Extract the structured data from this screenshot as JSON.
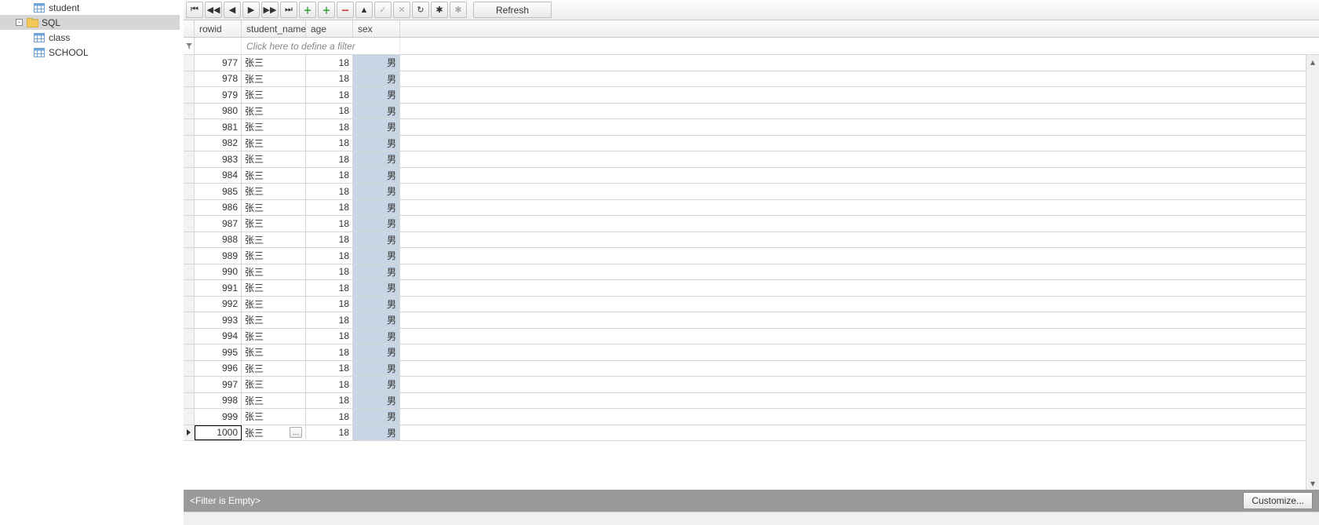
{
  "sidebar": {
    "items": [
      {
        "label": "student",
        "icon": "table-icon",
        "indent": 42,
        "selected": false,
        "expander": null
      },
      {
        "label": "SQL",
        "icon": "folder-icon",
        "indent": 20,
        "selected": true,
        "expander": "-"
      },
      {
        "label": "class",
        "icon": "table-icon",
        "indent": 42,
        "selected": false,
        "expander": null
      },
      {
        "label": "SCHOOL",
        "icon": "table-icon",
        "indent": 42,
        "selected": false,
        "expander": null
      }
    ]
  },
  "toolbar": {
    "nav": {
      "first": "⏮",
      "prev_page": "◀◀",
      "prev": "◀",
      "next": "▶",
      "next_page": "▶▶",
      "last": "⏭"
    },
    "edit": {
      "add": "＋",
      "insert": "＋",
      "delete": "－",
      "edit": "▲",
      "post": "✓",
      "cancel": "✕",
      "refresh_one": "↻",
      "bookmark": "✱",
      "goto_bm": "✱"
    },
    "refresh_label": "Refresh"
  },
  "grid": {
    "columns": {
      "rowid": "rowid",
      "student_name": "student_name",
      "age": "age",
      "sex": "sex"
    },
    "filter_placeholder": "Click here to define a filter",
    "rows": [
      {
        "rowid": 977,
        "student_name": "张三",
        "age": 18,
        "sex": "男"
      },
      {
        "rowid": 978,
        "student_name": "张三",
        "age": 18,
        "sex": "男"
      },
      {
        "rowid": 979,
        "student_name": "张三",
        "age": 18,
        "sex": "男"
      },
      {
        "rowid": 980,
        "student_name": "张三",
        "age": 18,
        "sex": "男"
      },
      {
        "rowid": 981,
        "student_name": "张三",
        "age": 18,
        "sex": "男"
      },
      {
        "rowid": 982,
        "student_name": "张三",
        "age": 18,
        "sex": "男"
      },
      {
        "rowid": 983,
        "student_name": "张三",
        "age": 18,
        "sex": "男"
      },
      {
        "rowid": 984,
        "student_name": "张三",
        "age": 18,
        "sex": "男"
      },
      {
        "rowid": 985,
        "student_name": "张三",
        "age": 18,
        "sex": "男"
      },
      {
        "rowid": 986,
        "student_name": "张三",
        "age": 18,
        "sex": "男"
      },
      {
        "rowid": 987,
        "student_name": "张三",
        "age": 18,
        "sex": "男"
      },
      {
        "rowid": 988,
        "student_name": "张三",
        "age": 18,
        "sex": "男"
      },
      {
        "rowid": 989,
        "student_name": "张三",
        "age": 18,
        "sex": "男"
      },
      {
        "rowid": 990,
        "student_name": "张三",
        "age": 18,
        "sex": "男"
      },
      {
        "rowid": 991,
        "student_name": "张三",
        "age": 18,
        "sex": "男"
      },
      {
        "rowid": 992,
        "student_name": "张三",
        "age": 18,
        "sex": "男"
      },
      {
        "rowid": 993,
        "student_name": "张三",
        "age": 18,
        "sex": "男"
      },
      {
        "rowid": 994,
        "student_name": "张三",
        "age": 18,
        "sex": "男"
      },
      {
        "rowid": 995,
        "student_name": "张三",
        "age": 18,
        "sex": "男"
      },
      {
        "rowid": 996,
        "student_name": "张三",
        "age": 18,
        "sex": "男"
      },
      {
        "rowid": 997,
        "student_name": "张三",
        "age": 18,
        "sex": "男"
      },
      {
        "rowid": 998,
        "student_name": "张三",
        "age": 18,
        "sex": "男"
      },
      {
        "rowid": 999,
        "student_name": "张三",
        "age": 18,
        "sex": "男"
      },
      {
        "rowid": 1000,
        "student_name": "张三",
        "age": 18,
        "sex": "男",
        "current": true
      }
    ],
    "ellipsis_label": "…"
  },
  "filterbar": {
    "status": "<Filter is Empty>",
    "customize_label": "Customize..."
  },
  "colors": {
    "highlight_col": "#c7d5e4",
    "tree_select": "#d6d6d6",
    "statusbar": "#9a9a9a"
  }
}
